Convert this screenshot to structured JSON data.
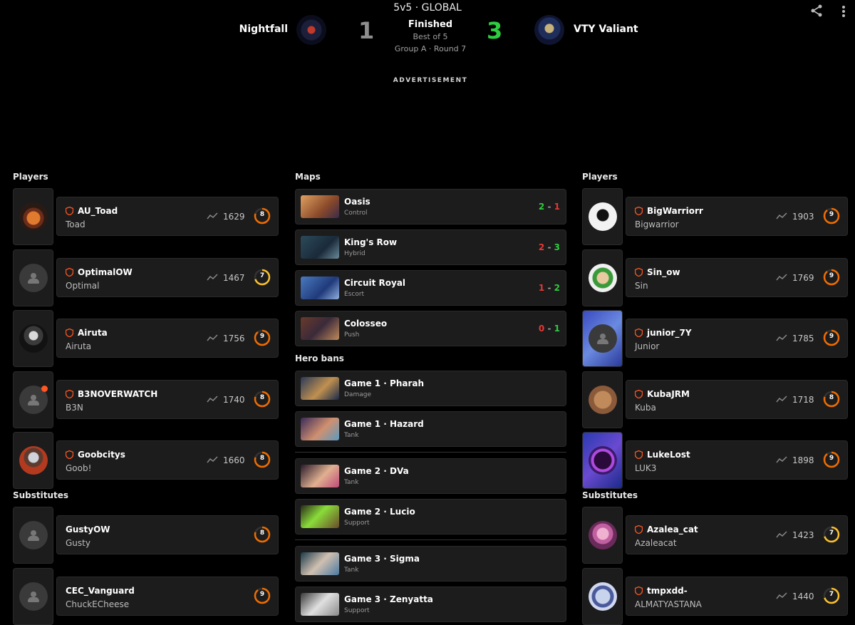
{
  "header": {
    "mode": "5v5 · GLOBAL",
    "team_left": "Nightfall",
    "team_right": "VTY Valiant",
    "score_left": "1",
    "score_right": "3",
    "status": "Finished",
    "best_of": "Best of 5",
    "group": "Group A · Round 7",
    "ad_label": "ADVERTISEMENT"
  },
  "left": {
    "players_title": "Players",
    "substitutes_title": "Substitutes",
    "players": [
      {
        "name": "AU_Toad",
        "real": "Toad",
        "elo": "1629",
        "rank": "8",
        "rank_color": "#ef6c00"
      },
      {
        "name": "OptimalOW",
        "real": "Optimal",
        "elo": "1467",
        "rank": "7",
        "rank_color": "#fbc02d"
      },
      {
        "name": "Airuta",
        "real": "Airuta",
        "elo": "1756",
        "rank": "9",
        "rank_color": "#ef6c00"
      },
      {
        "name": "B3NOVERWATCH",
        "real": "B3N",
        "elo": "1740",
        "rank": "8",
        "rank_color": "#ef6c00"
      },
      {
        "name": "Goobcitys",
        "real": "Goob!",
        "elo": "1660",
        "rank": "8",
        "rank_color": "#ef6c00"
      }
    ],
    "subs": [
      {
        "name": "GustyOW",
        "real": "Gusty",
        "rank": "8",
        "rank_color": "#ef6c00"
      },
      {
        "name": "CEC_Vanguard",
        "real": "ChuckECheese",
        "rank": "9",
        "rank_color": "#ef6c00"
      }
    ]
  },
  "middle": {
    "maps_title": "Maps",
    "maps": [
      {
        "name": "Oasis",
        "type": "Control",
        "a": "2",
        "b": "1",
        "a_col": "g",
        "b_col": "r"
      },
      {
        "name": "King's Row",
        "type": "Hybrid",
        "a": "2",
        "b": "3",
        "a_col": "r",
        "b_col": "g"
      },
      {
        "name": "Circuit Royal",
        "type": "Escort",
        "a": "1",
        "b": "2",
        "a_col": "r",
        "b_col": "g"
      },
      {
        "name": "Colosseo",
        "type": "Push",
        "a": "0",
        "b": "1",
        "a_col": "r",
        "b_col": "g"
      }
    ],
    "bans_title": "Hero bans",
    "bans": [
      {
        "name": "Game 1 · Pharah",
        "role": "Damage"
      },
      {
        "name": "Game 1 · Hazard",
        "role": "Tank"
      },
      {
        "name": "Game 2 · DVa",
        "role": "Tank"
      },
      {
        "name": "Game 2 · Lucio",
        "role": "Support"
      },
      {
        "name": "Game 3 · Sigma",
        "role": "Tank"
      },
      {
        "name": "Game 3 · Zenyatta",
        "role": "Support"
      }
    ],
    "dash": "-"
  },
  "right": {
    "players_title": "Players",
    "substitutes_title": "Substitutes",
    "players": [
      {
        "name": "BigWarriorr",
        "real": "Bigwarrior",
        "elo": "1903",
        "rank": "9",
        "rank_color": "#ef6c00"
      },
      {
        "name": "Sin_ow",
        "real": "Sin",
        "elo": "1769",
        "rank": "9",
        "rank_color": "#ef6c00"
      },
      {
        "name": "junior_7Y",
        "real": "Junior",
        "elo": "1785",
        "rank": "9",
        "rank_color": "#ef6c00"
      },
      {
        "name": "KubaJRM",
        "real": "Kuba",
        "elo": "1718",
        "rank": "8",
        "rank_color": "#ef6c00"
      },
      {
        "name": "LukeLost",
        "real": "LUK3",
        "elo": "1898",
        "rank": "9",
        "rank_color": "#ef6c00"
      }
    ],
    "subs": [
      {
        "name": "Azalea_cat",
        "real": "Azaleacat",
        "elo": "1423",
        "rank": "7",
        "rank_color": "#fbc02d"
      },
      {
        "name": "tmpxdd-",
        "real": "ALMATYASTANA",
        "elo": "1440",
        "rank": "7",
        "rank_color": "#fbc02d"
      }
    ]
  },
  "icons": {
    "share": "share-icon",
    "more": "more-vertical-icon",
    "shield": "shield-icon",
    "trend": "trend-icon"
  }
}
